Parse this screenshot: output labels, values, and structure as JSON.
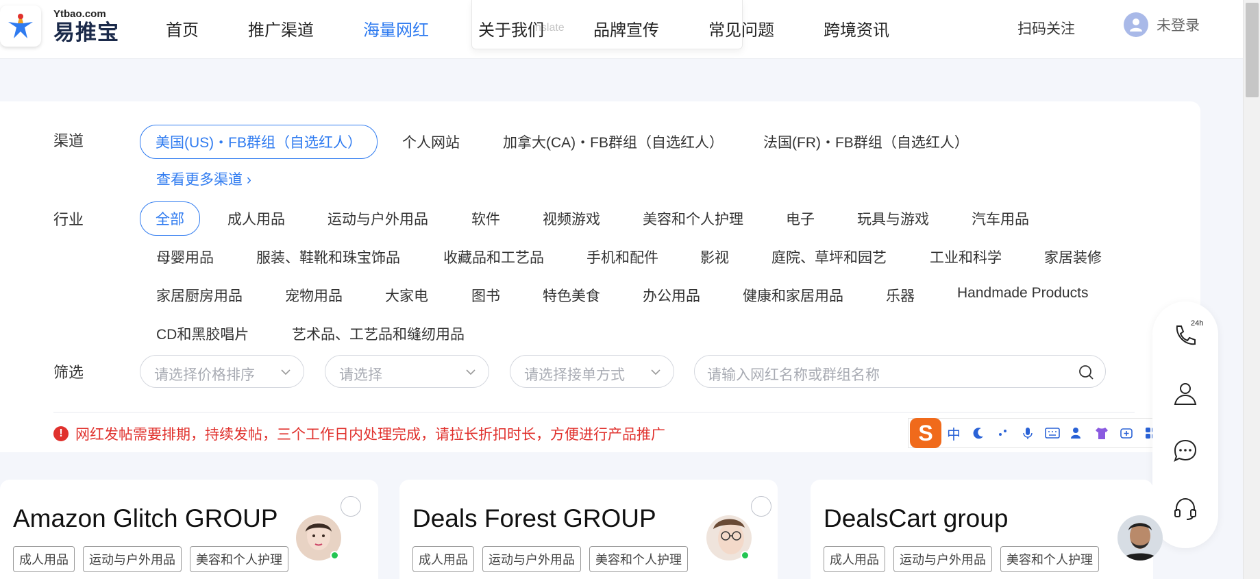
{
  "header": {
    "logo_small": "Ytbao.com",
    "logo_big": "易推宝",
    "nav": [
      "首页",
      "推广渠道",
      "海量网红",
      "关于我们",
      "品牌宣传",
      "常见问题",
      "跨境资讯"
    ],
    "active_nav": "海量网红",
    "translate_popup_text": "nslate",
    "qr_follow": "扫码关注",
    "user_label": "未登录"
  },
  "filters": {
    "channel_label": "渠道",
    "channels": [
      "美国(US)・FB群组（自选红人）",
      "个人网站",
      "加拿大(CA)・FB群组（自选红人）",
      "法国(FR)・FB群组（自选红人）"
    ],
    "selected_channel": "美国(US)・FB群组（自选红人）",
    "more_channels": "查看更多渠道",
    "industry_label": "行业",
    "industries": [
      "全部",
      "成人用品",
      "运动与户外用品",
      "软件",
      "视频游戏",
      "美容和个人护理",
      "电子",
      "玩具与游戏",
      "汽车用品",
      "母婴用品",
      "服装、鞋靴和珠宝饰品",
      "收藏品和工艺品",
      "手机和配件",
      "影视",
      "庭院、草坪和园艺",
      "工业和科学",
      "家居装修",
      "家居厨房用品",
      "宠物用品",
      "大家电",
      "图书",
      "特色美食",
      "办公用品",
      "健康和家居用品",
      "乐器",
      "Handmade Products",
      "CD和黑胶唱片",
      "艺术品、工艺品和缝纫用品"
    ],
    "selected_industry": "全部",
    "screen_label": "筛选",
    "price_sort_placeholder": "请选择价格排序",
    "select_placeholder": "请选择",
    "order_method_placeholder": "请选择接单方式",
    "search_placeholder": "请输入网红名称或群组名称"
  },
  "notice": "网红发帖需要排期，持续发帖，三个工作日内处理完成，请拉长折扣时长，方便进行产品推广",
  "ime": {
    "logo": "S",
    "mode": "中"
  },
  "side_icons": [
    "phone-24h-icon",
    "contact-person-icon",
    "chat-bubble-icon",
    "headset-icon"
  ],
  "side_phone_badge": "24h",
  "cards": [
    {
      "title": "Amazon Glitch GROUP",
      "tags": [
        "成人用品",
        "运动与户外用品",
        "美容和个人护理"
      ],
      "online": true
    },
    {
      "title": "Deals Forest GROUP",
      "tags": [
        "成人用品",
        "运动与户外用品",
        "美容和个人护理"
      ],
      "online": true
    },
    {
      "title": "DealsCart group",
      "tags": [
        "成人用品",
        "运动与户外用品",
        "美容和个人护理"
      ],
      "online": false
    }
  ],
  "colors": {
    "accent": "#2f7bf0",
    "alert": "#e0312d",
    "ime_orange": "#f06a1b"
  }
}
